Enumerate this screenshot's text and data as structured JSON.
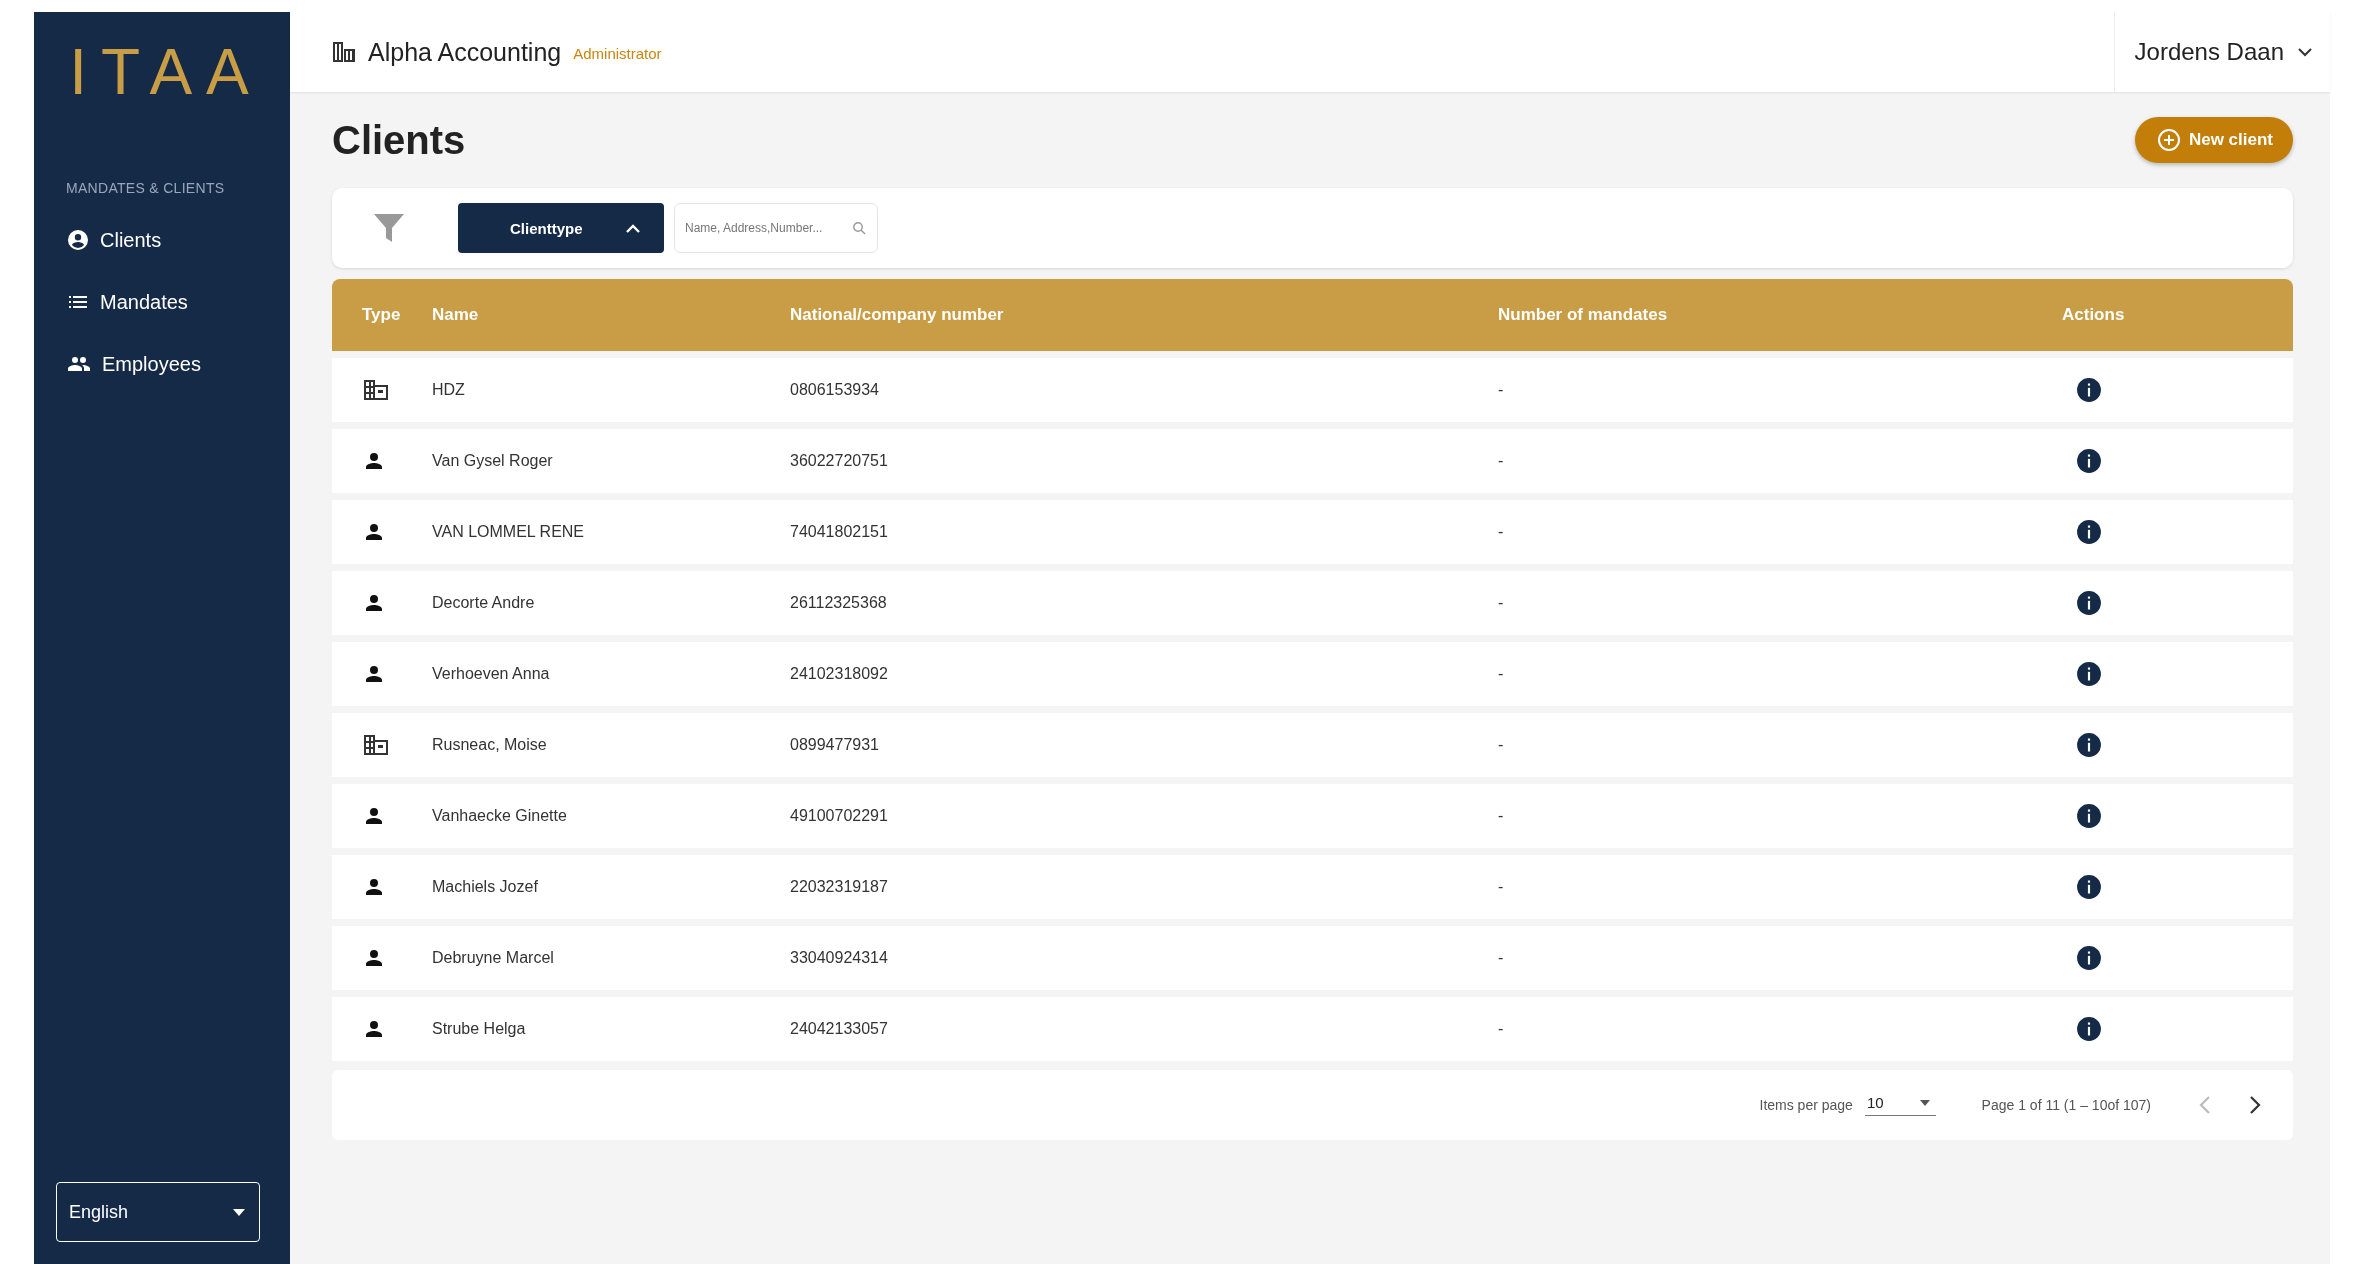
{
  "sidebar": {
    "logo": "ITAA",
    "section_title": "MANDATES & CLIENTS",
    "items": [
      {
        "label": "Clients"
      },
      {
        "label": "Mandates"
      },
      {
        "label": "Employees"
      }
    ],
    "language": "English"
  },
  "header": {
    "company": "Alpha Accounting",
    "role": "Administrator",
    "user": "Jordens Daan"
  },
  "page": {
    "title": "Clients",
    "new_button": "New client"
  },
  "filters": {
    "clienttype": "Clienttype",
    "expanded": true,
    "search": {
      "placeholder": "Name, Address,Number..."
    }
  },
  "table": {
    "columns": [
      "Type",
      "Name",
      "National/company number",
      "Number of mandates",
      "Actions"
    ],
    "rows": [
      {
        "kind": "company",
        "name": "HDZ",
        "number": "0806153934",
        "mandates": "-"
      },
      {
        "kind": "person",
        "name": "Van Gysel Roger",
        "number": "36022720751",
        "mandates": "-"
      },
      {
        "kind": "person",
        "name": "VAN LOMMEL RENE",
        "number": "74041802151",
        "mandates": "-"
      },
      {
        "kind": "person",
        "name": "Decorte Andre",
        "number": "26112325368",
        "mandates": "-"
      },
      {
        "kind": "person",
        "name": "Verhoeven Anna",
        "number": "24102318092",
        "mandates": "-"
      },
      {
        "kind": "company",
        "name": "Rusneac, Moise",
        "number": "0899477931",
        "mandates": "-"
      },
      {
        "kind": "person",
        "name": "Vanhaecke Ginette",
        "number": "49100702291",
        "mandates": "-"
      },
      {
        "kind": "person",
        "name": "Machiels Jozef",
        "number": "22032319187",
        "mandates": "-"
      },
      {
        "kind": "person",
        "name": "Debruyne Marcel",
        "number": "33040924314",
        "mandates": "-"
      },
      {
        "kind": "person",
        "name": "Strube Helga",
        "number": "24042133057",
        "mandates": "-"
      }
    ]
  },
  "pagination": {
    "items_per_page_label": "Items per page",
    "items_per_page": "10",
    "range": "Page 1 of 11 (1 – 10of 107)",
    "prev_disabled": true,
    "next_disabled": false
  }
}
